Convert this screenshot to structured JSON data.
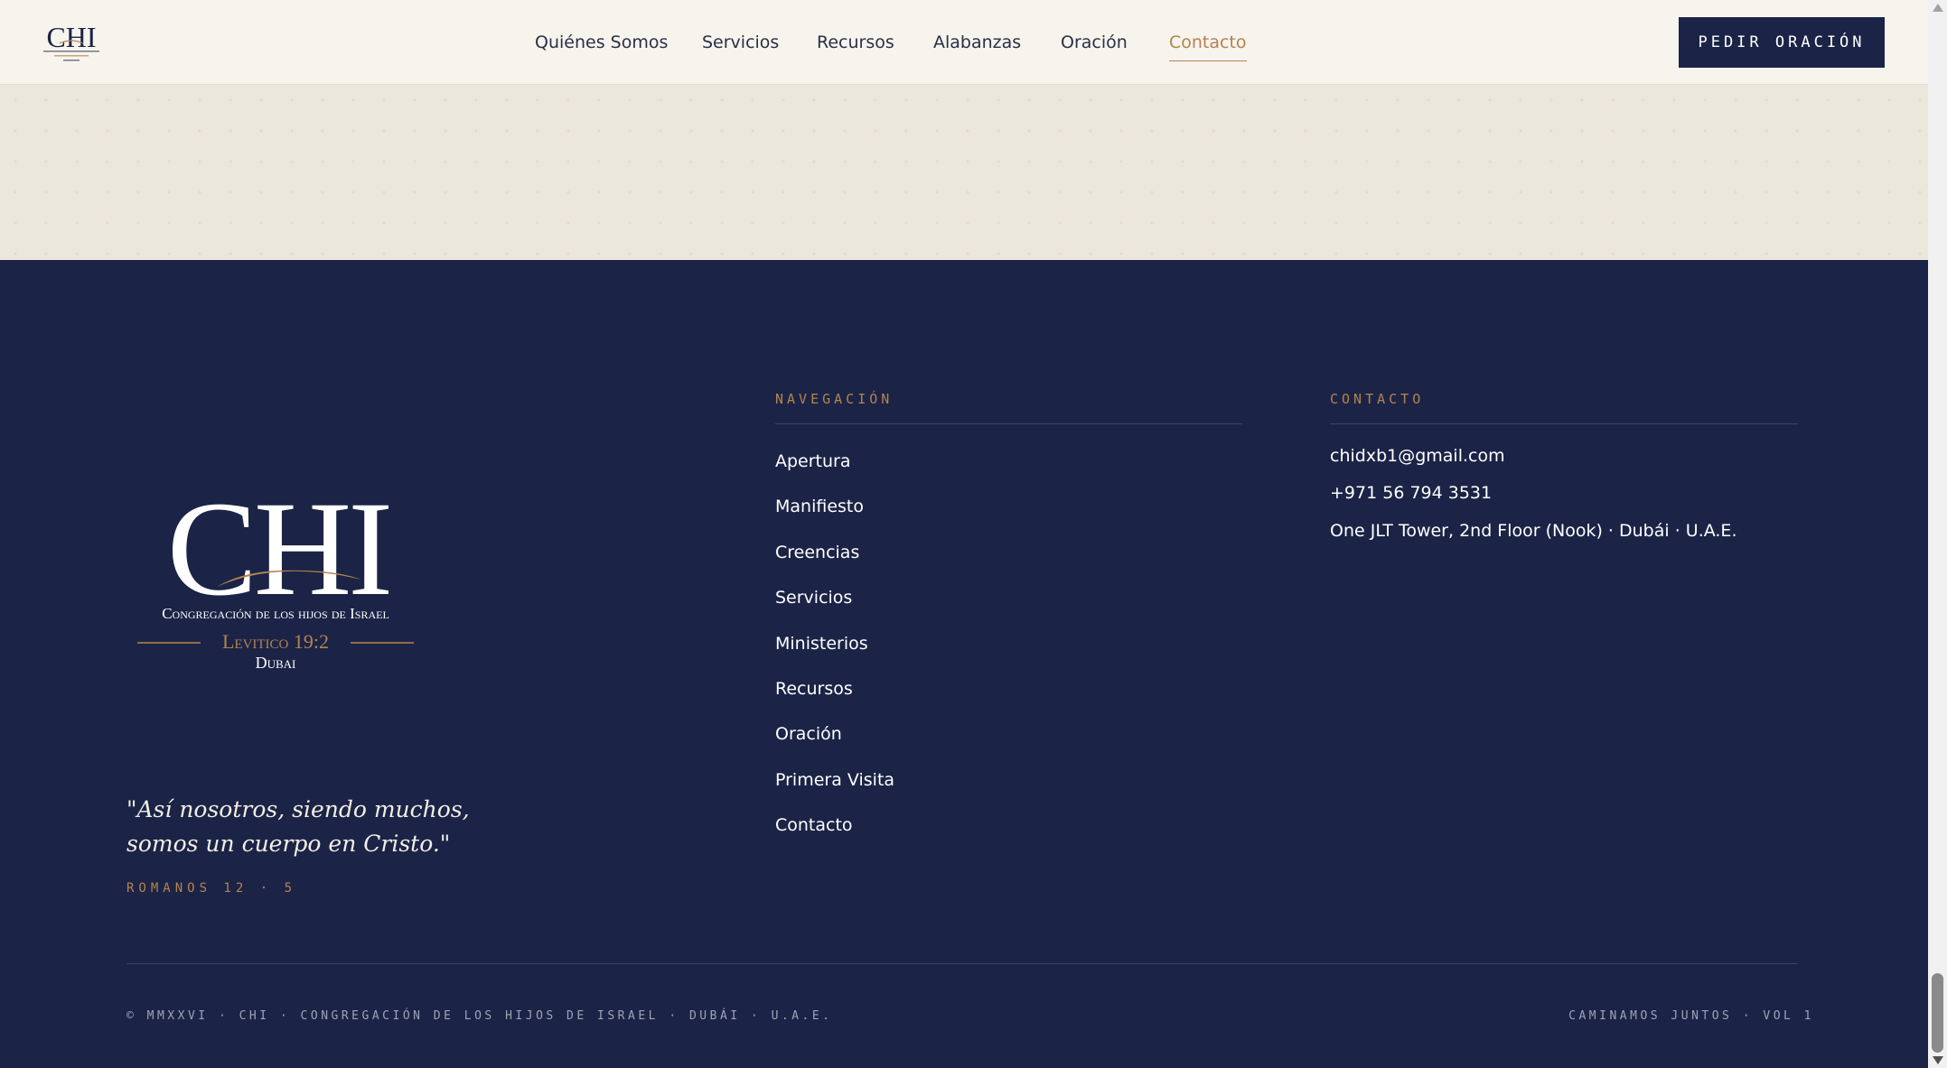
{
  "header": {
    "logo_text": "CHI",
    "nav": [
      {
        "label": "Quiénes Somos"
      },
      {
        "label": "Servicios"
      },
      {
        "label": "Recursos"
      },
      {
        "label": "Alabanzas"
      },
      {
        "label": "Oración"
      },
      {
        "label": "Contacto",
        "active": true
      }
    ],
    "cta_label": "PEDIR ORACIÓN"
  },
  "footer": {
    "logo": {
      "mark": "CHI",
      "line1": "Congregación de los hijos de Israel",
      "line2": "Levitico 19:2",
      "line3": "Dubai"
    },
    "quote": "\"Así nosotros, siendo muchos, somos un cuerpo en Cristo.\"",
    "quote_ref": "ROMANOS 12 · 5",
    "navigation": {
      "title": "NAVEGACIÓN",
      "links": [
        "Apertura",
        "Manifiesto",
        "Creencias",
        "Servicios",
        "Ministerios",
        "Recursos",
        "Oración",
        "Primera Visita",
        "Contacto"
      ]
    },
    "contact": {
      "title": "CONTACTO",
      "email": "chidxb1@gmail.com",
      "phone": "+971 56 794 3531",
      "address": "One JLT Tower, 2nd Floor (Nook) · Dubái · U.A.E."
    },
    "copyright": "© MMXXVI · CHI · CONGREGACIÓN DE LOS HIJOS DE ISRAEL · DUBÁI · U.A.E.",
    "tagline": "CAMINAMOS JUNTOS · VOL 1"
  },
  "colors": {
    "navy": "#1b2446",
    "gold": "#b3834f",
    "cream": "#f7f4ee"
  }
}
